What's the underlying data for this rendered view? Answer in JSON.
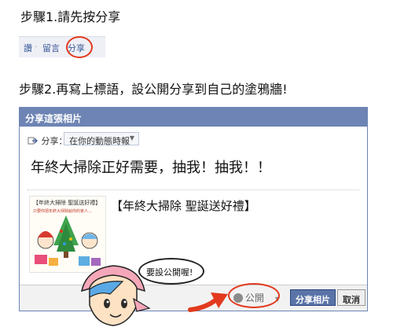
{
  "step1": {
    "title": "步驟1.請先按分享"
  },
  "action_bar": {
    "like": "讚",
    "comment": "留言",
    "share": "分享",
    "sep": "·"
  },
  "step2": {
    "title": "步驟2.再寫上標語，設公開分享到自己的塗鴉牆!"
  },
  "dialog": {
    "header": "分享這張相片",
    "share_label": "分享：",
    "share_target": "在你的動態時報",
    "post_text": "年終大掃除正好需要，抽我！抽我！！",
    "link_title": "【年終大掃除 聖誕送好禮】",
    "thumbnail": {
      "title": "【年終大掃除 聖誕送好禮】",
      "caption": "只要你把年終大掃除給你的家人..."
    },
    "privacy": "公開",
    "share_button": "分享相片",
    "cancel_button": "取消"
  },
  "callout": {
    "text": "要設公開喔!"
  },
  "colors": {
    "facebook_blue": "#6d84b4",
    "link_blue": "#3b5998",
    "highlight_red": "#e23a1e"
  },
  "icons": {
    "share_icon": "share-icon",
    "globe_icon": "globe-icon",
    "arrow": "arrow-icon"
  }
}
